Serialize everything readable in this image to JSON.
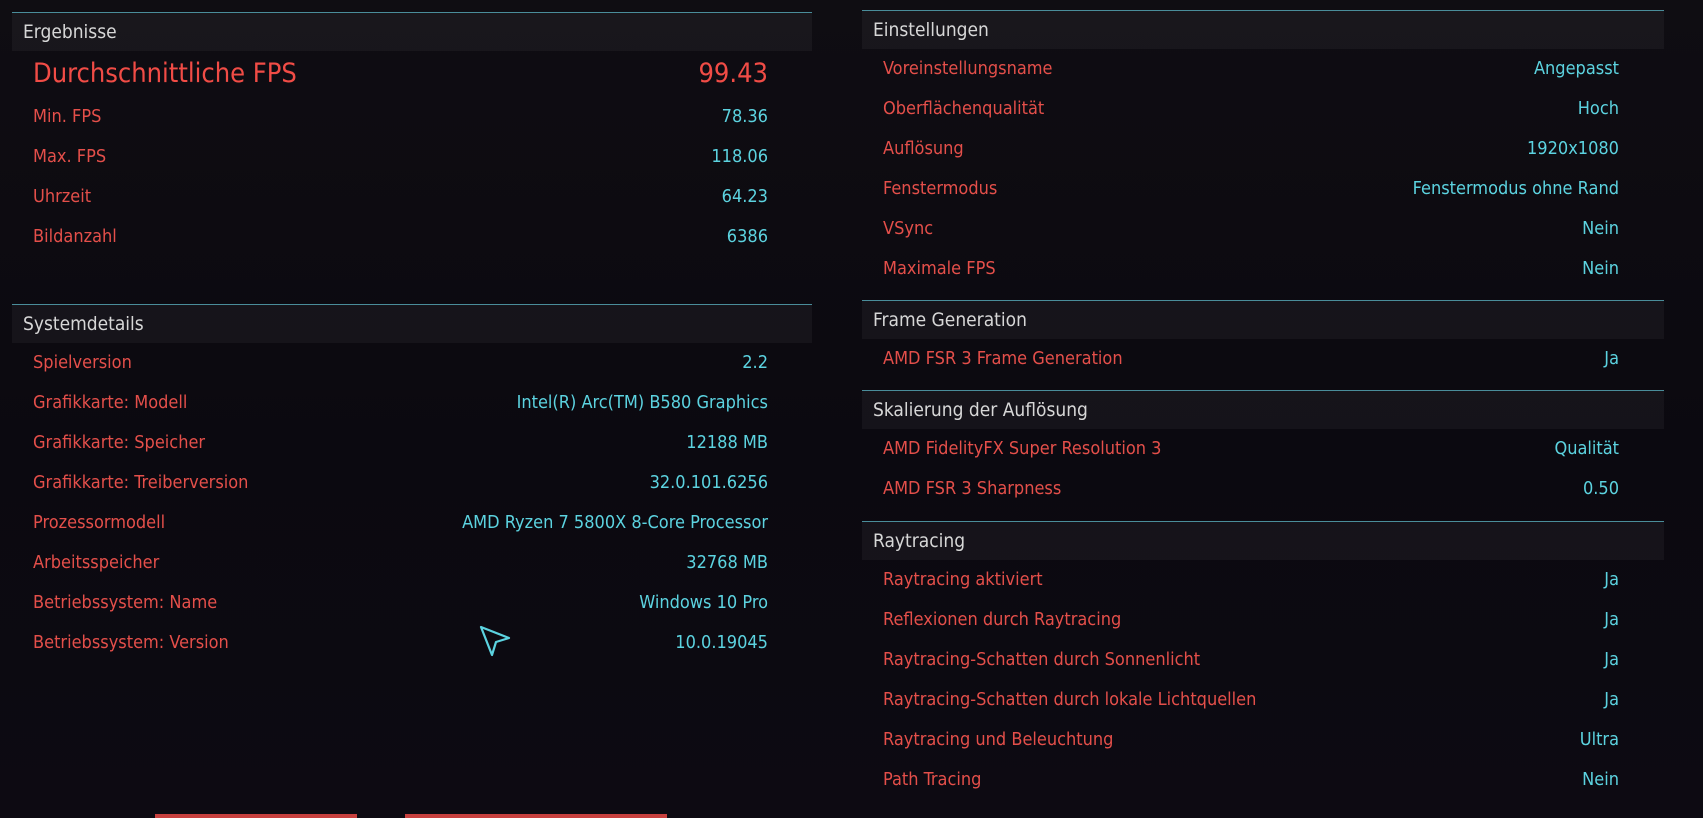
{
  "results": {
    "title": "Ergebnisse",
    "avg_fps": {
      "label": "Durchschnittliche FPS",
      "value": "99.43"
    },
    "rows": [
      {
        "label": "Min. FPS",
        "value": "78.36"
      },
      {
        "label": "Max. FPS",
        "value": "118.06"
      },
      {
        "label": "Uhrzeit",
        "value": "64.23"
      },
      {
        "label": "Bildanzahl",
        "value": "6386"
      }
    ]
  },
  "system": {
    "title": "Systemdetails",
    "rows": [
      {
        "label": "Spielversion",
        "value": "2.2"
      },
      {
        "label": "Grafikkarte: Modell",
        "value": "Intel(R) Arc(TM) B580 Graphics"
      },
      {
        "label": "Grafikkarte: Speicher",
        "value": "12188 MB"
      },
      {
        "label": "Grafikkarte: Treiberversion",
        "value": "32.0.101.6256"
      },
      {
        "label": "Prozessormodell",
        "value": "AMD Ryzen 7 5800X 8-Core Processor"
      },
      {
        "label": "Arbeitsspeicher",
        "value": "32768 MB"
      },
      {
        "label": "Betriebssystem: Name",
        "value": "Windows 10 Pro"
      },
      {
        "label": "Betriebssystem: Version",
        "value": "10.0.19045"
      }
    ]
  },
  "settings": {
    "title": "Einstellungen",
    "rows": [
      {
        "label": "Voreinstellungsname",
        "value": "Angepasst"
      },
      {
        "label": "Oberflächenqualität",
        "value": "Hoch"
      },
      {
        "label": "Auflösung",
        "value": "1920x1080"
      },
      {
        "label": "Fenstermodus",
        "value": "Fenstermodus ohne Rand"
      },
      {
        "label": "VSync",
        "value": "Nein"
      },
      {
        "label": "Maximale FPS",
        "value": "Nein"
      }
    ]
  },
  "frame_generation": {
    "title": "Frame Generation",
    "rows": [
      {
        "label": "AMD FSR 3 Frame Generation",
        "value": "Ja"
      }
    ]
  },
  "scaling": {
    "title": "Skalierung der Auflösung",
    "rows": [
      {
        "label": "AMD FidelityFX Super Resolution 3",
        "value": "Qualität"
      },
      {
        "label": "AMD FSR 3 Sharpness",
        "value": "0.50"
      }
    ]
  },
  "raytracing": {
    "title": "Raytracing",
    "rows": [
      {
        "label": "Raytracing aktiviert",
        "value": "Ja"
      },
      {
        "label": "Reflexionen durch Raytracing",
        "value": "Ja"
      },
      {
        "label": "Raytracing-Schatten durch Sonnenlicht",
        "value": "Ja"
      },
      {
        "label": "Raytracing-Schatten durch lokale Lichtquellen",
        "value": "Ja"
      },
      {
        "label": "Raytracing und Beleuchtung",
        "value": "Ultra"
      },
      {
        "label": "Path Tracing",
        "value": "Nein"
      }
    ]
  },
  "colors": {
    "label_red": "#e44f4a",
    "value_cyan": "#5cd3e0",
    "header_line": "#4a8d9a"
  },
  "icons": {
    "cursor": "arrow-cursor-icon"
  }
}
